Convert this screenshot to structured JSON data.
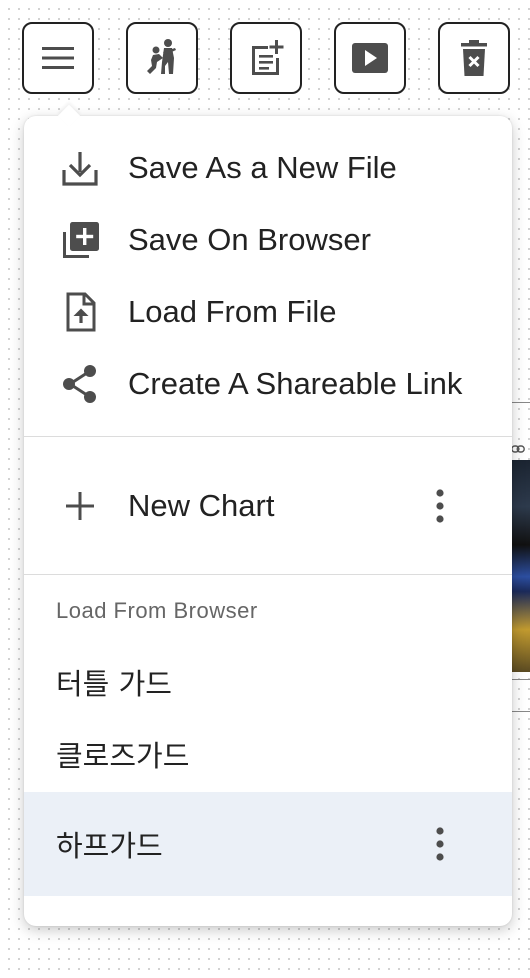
{
  "toolbar": {
    "buttons": [
      {
        "name": "menu-button",
        "icon": "hamburger-icon"
      },
      {
        "name": "tactics-button",
        "icon": "players-icon"
      },
      {
        "name": "new-note-button",
        "icon": "note-add-icon"
      },
      {
        "name": "play-button",
        "icon": "play-icon"
      },
      {
        "name": "delete-button",
        "icon": "trash-icon"
      }
    ]
  },
  "menu": {
    "actions": [
      {
        "label": "Save As a New File",
        "icon": "download-icon"
      },
      {
        "label": "Save On Browser",
        "icon": "library-add-icon"
      },
      {
        "label": "Load From File",
        "icon": "file-upload-icon"
      },
      {
        "label": "Create A Shareable Link",
        "icon": "share-icon"
      }
    ],
    "new_chart": {
      "label": "New Chart",
      "icon": "plus-icon"
    },
    "section_title": "Load From Browser",
    "saved_items": [
      {
        "label": "터틀 가드",
        "selected": false
      },
      {
        "label": "클로즈가드",
        "selected": false
      },
      {
        "label": "하프가드",
        "selected": true
      }
    ]
  },
  "colors": {
    "icon": "#4d4d4d",
    "selected_bg": "#ebf0f7",
    "separator": "#dcdcdc",
    "border": "#222222"
  }
}
